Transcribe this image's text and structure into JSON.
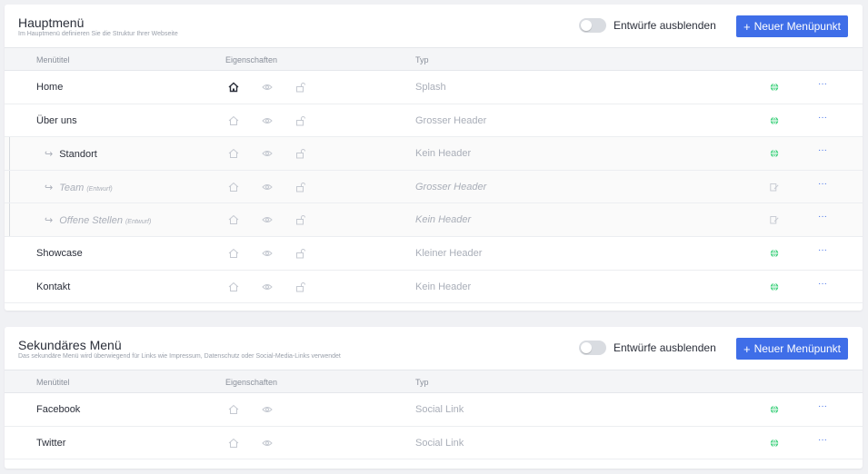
{
  "colors": {
    "accent": "#3f6ee8",
    "online": "#2ecc71",
    "muted": "#a9aeb8"
  },
  "menus": [
    {
      "title": "Hauptmenü",
      "subtitle": "Im Hauptmenü definieren Sie die Struktur Ihrer Webseite",
      "toggle_label": "Entwürfe ausblenden",
      "button_label": "Neuer Menüpunkt",
      "columns": {
        "title": "Menütitel",
        "props": "Eigenschaften",
        "type": "Typ"
      },
      "rows": [
        {
          "title": "Home",
          "type": "Splash",
          "draft_tag": "",
          "arrow": "",
          "status_icon": "globe-icon"
        },
        {
          "title": "Über uns",
          "type": "Grosser Header",
          "draft_tag": "",
          "arrow": "",
          "status_icon": "globe-icon"
        },
        {
          "title": "Standort",
          "type": "Kein Header",
          "draft_tag": "",
          "arrow": "↪",
          "status_icon": "globe-icon"
        },
        {
          "title": "Team",
          "type": "Grosser Header",
          "draft_tag": "(Entwurf)",
          "arrow": "↪",
          "status_icon": "edit-icon"
        },
        {
          "title": "Offene Stellen",
          "type": "Kein Header",
          "draft_tag": "(Entwurf)",
          "arrow": "↪",
          "status_icon": "edit-icon"
        },
        {
          "title": "Showcase",
          "type": "Kleiner Header",
          "draft_tag": "",
          "arrow": "",
          "status_icon": "globe-icon"
        },
        {
          "title": "Kontakt",
          "type": "Kein Header",
          "draft_tag": "",
          "arrow": "",
          "status_icon": "globe-icon"
        }
      ]
    },
    {
      "title": "Sekundäres Menü",
      "subtitle": "Das sekundäre Menü wird überwiegend für Links wie Impressum, Datenschutz oder Social-Media-Links verwendet",
      "toggle_label": "Entwürfe ausblenden",
      "button_label": "Neuer Menüpunkt",
      "columns": {
        "title": "Menütitel",
        "props": "Eigenschaften",
        "type": "Typ"
      },
      "rows": [
        {
          "title": "Facebook",
          "type": "Social Link",
          "status_icon": "globe-icon"
        },
        {
          "title": "Twitter",
          "type": "Social Link",
          "status_icon": "globe-icon"
        }
      ]
    }
  ],
  "more_label": "···"
}
